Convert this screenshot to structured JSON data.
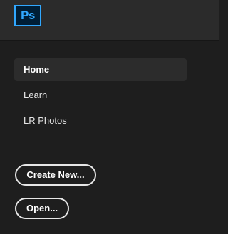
{
  "app": {
    "logo_text": "Ps",
    "logo_color": "#31a8ff",
    "logo_bg": "#001e36"
  },
  "sidebar": {
    "items": [
      {
        "label": "Home",
        "active": true
      },
      {
        "label": "Learn",
        "active": false
      },
      {
        "label": "LR Photos",
        "active": false
      }
    ]
  },
  "actions": {
    "create_new_label": "Create New...",
    "open_label": "Open..."
  }
}
